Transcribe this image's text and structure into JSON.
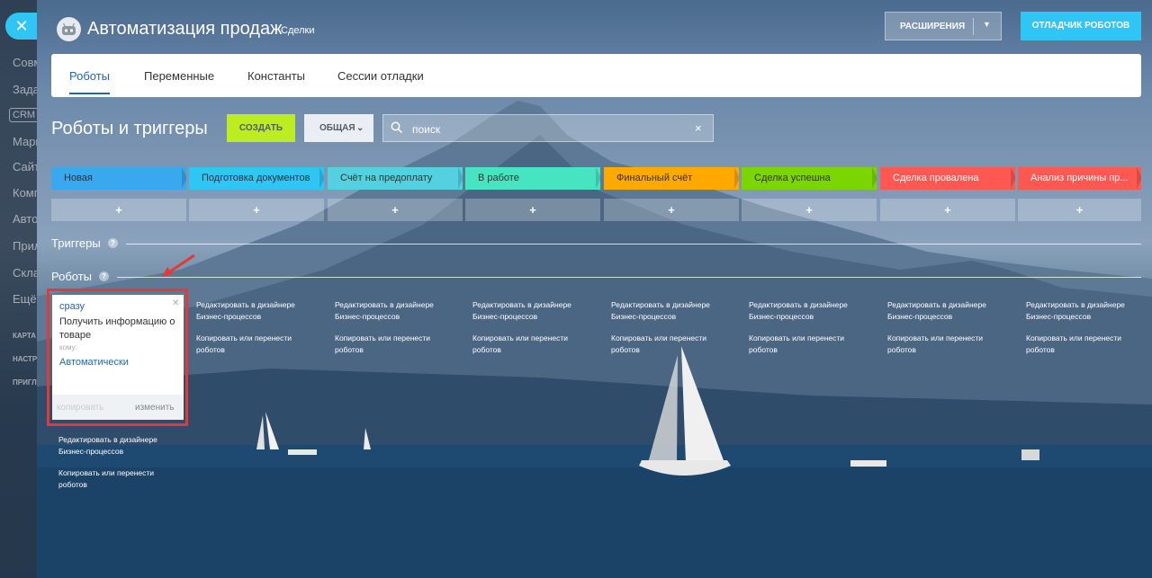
{
  "header": {
    "title": "Автоматизация продаж",
    "subtitle": "Сделки",
    "extensions_label": "РАСШИРЕНИЯ",
    "debugger_label": "ОТЛАДЧИК РОБОТОВ"
  },
  "sidebar": {
    "items": [
      "Совм",
      "Зада",
      "CRM",
      "Марк",
      "Сайт",
      "Комп",
      "Авто",
      "Прил",
      "Скла",
      "Ещё",
      "КАРТА",
      "НАСТР",
      "ПРИГЛ"
    ]
  },
  "tabs": [
    {
      "label": "Роботы",
      "active": true
    },
    {
      "label": "Переменные"
    },
    {
      "label": "Константы"
    },
    {
      "label": "Сессии отладки"
    }
  ],
  "toolbar": {
    "heading": "Роботы и триггеры",
    "create_label": "СОЗДАТЬ",
    "general_label": "ОБЩАЯ",
    "search_placeholder": "поиск"
  },
  "stages": [
    {
      "label": "Новая",
      "color": "#39a8ef"
    },
    {
      "label": "Подготовка документов",
      "color": "#2fc6f6"
    },
    {
      "label": "Счёт на предоплату",
      "color": "#55d0e0"
    },
    {
      "label": "В работе",
      "color": "#47e4c2"
    },
    {
      "label": "Финальный счёт",
      "color": "#ffa900"
    },
    {
      "label": "Сделка успешна",
      "color": "#7bd500"
    },
    {
      "label": "Сделка провалена",
      "color": "#ff5752"
    },
    {
      "label": "Анализ причины пр...",
      "color": "#ff5752"
    }
  ],
  "sections": {
    "triggers": "Триггеры",
    "robots": "Роботы"
  },
  "robot_card": {
    "when": "сразу",
    "name": "Получить информацию о товаре",
    "to_label": "кому:",
    "assignee": "Автоматически",
    "copy_label": "копировать",
    "edit_label": "изменить"
  },
  "column_links": {
    "designer_1": "Редактировать в дизайнере",
    "designer_2": "Бизнес-процессов",
    "copy_1": "Копировать или перенести",
    "copy_2": "роботов"
  }
}
